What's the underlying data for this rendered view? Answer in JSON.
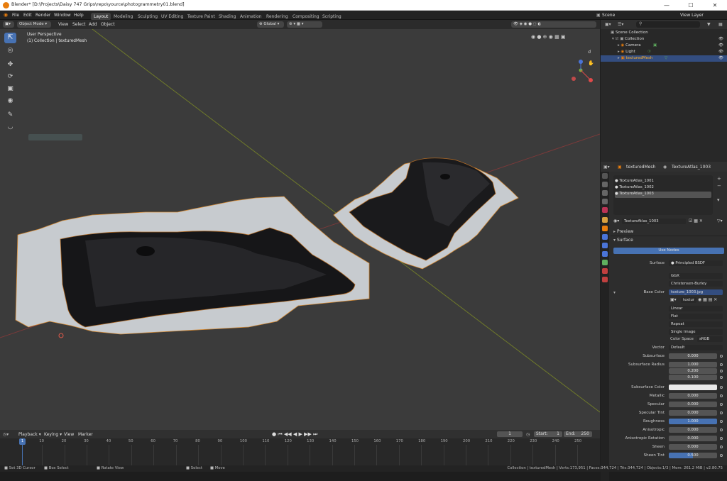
{
  "titlebar": {
    "title": "Blender* [D:\\Projects\\Daisy 747 Grips\\repo\\yource\\photogrammetry01.blend]"
  },
  "menu": {
    "items": [
      "File",
      "Edit",
      "Render",
      "Window",
      "Help"
    ]
  },
  "workspaces": [
    "Layout",
    "Modeling",
    "Sculpting",
    "UV Editing",
    "Texture Paint",
    "Shading",
    "Animation",
    "Rendering",
    "Compositing",
    "Scripting"
  ],
  "active_workspace": "Layout",
  "scene": {
    "label": "Scene",
    "view_layer": "View Layer"
  },
  "viewport": {
    "mode": "Object Mode",
    "menus": [
      "View",
      "Select",
      "Add",
      "Object"
    ],
    "orientation": "Global",
    "overlay_title": "User Perspective",
    "overlay_sub": "(1) Collection | texturedMesh"
  },
  "outliner": {
    "rows": [
      {
        "label": "Scene Collection"
      },
      {
        "label": "Collection"
      },
      {
        "label": "Camera"
      },
      {
        "label": "Light"
      },
      {
        "label": "texturedMesh"
      }
    ]
  },
  "properties": {
    "object": "texturedMesh",
    "material_slot": "TextureAtlas_1003",
    "slots": [
      "TextureAtlas_1001",
      "TextureAtlas_1002",
      "TextureAtlas_1003"
    ],
    "material_name": "TextureAtlas_1003",
    "preview": "Preview",
    "surface_header": "Surface",
    "use_nodes": "Use Nodes",
    "surface_label": "Surface",
    "surface_value": "Principled BSDF",
    "distribution": "GGX",
    "subsurface_method": "Christensen-Burley",
    "base_color_label": "Base Color",
    "base_color_value": "texture_1003.jpg",
    "image_name": "textur",
    "interpolation": "Linear",
    "projection": "Flat",
    "extension": "Repeat",
    "source": "Single Image",
    "color_space_label": "Color Space",
    "color_space_value": "sRGB",
    "vector_label": "Vector",
    "vector_value": "Default",
    "params": [
      {
        "label": "Subsurface",
        "value": "0.000",
        "fill": 0
      },
      {
        "label": "Subsurface Radius",
        "value": "1.000",
        "fill": 0
      },
      {
        "label": "",
        "value": "0.200",
        "fill": 0
      },
      {
        "label": "",
        "value": "0.100",
        "fill": 0
      },
      {
        "label": "Subsurface Color",
        "value": "",
        "fill": 0
      },
      {
        "label": "Metallic",
        "value": "0.000",
        "fill": 0
      },
      {
        "label": "Specular",
        "value": "0.000",
        "fill": 0
      },
      {
        "label": "Specular Tint",
        "value": "0.000",
        "fill": 0
      },
      {
        "label": "Roughness",
        "value": "1.000",
        "fill": 1
      },
      {
        "label": "Anisotropic",
        "value": "0.000",
        "fill": 0
      },
      {
        "label": "Anisotropic Rotation",
        "value": "0.000",
        "fill": 0
      },
      {
        "label": "Sheen",
        "value": "0.000",
        "fill": 0
      },
      {
        "label": "Sheen Tint",
        "value": "0.500",
        "fill": 0.5
      }
    ]
  },
  "timeline": {
    "menus": [
      "Playback",
      "Keying",
      "View",
      "Marker"
    ],
    "current_frame": "1",
    "start_label": "Start:",
    "start": "1",
    "end_label": "End:",
    "end": "250",
    "ticks": [
      "1",
      "10",
      "20",
      "30",
      "40",
      "50",
      "60",
      "70",
      "80",
      "90",
      "100",
      "110",
      "120",
      "130",
      "140",
      "150",
      "160",
      "170",
      "180",
      "190",
      "200",
      "210",
      "220",
      "230",
      "240",
      "250"
    ],
    "playhead": "1"
  },
  "statusbar": {
    "left": [
      "Set 3D Cursor",
      "Box Select",
      "Rotate View",
      "Select",
      "Move"
    ],
    "right": "Collection | texturedMesh | Verts:173,951 | Faces:344,724 | Tris:344,724 | Objects:1/3 | Mem: 261.2 MiB | v2.80.75"
  },
  "colors": {
    "accent": "#4772b3",
    "selection": "#334d80",
    "orange": "#e87d0d"
  },
  "icons": [
    "blender-logo-icon",
    "minimize-icon",
    "maximize-icon",
    "close-icon",
    "cursor-icon",
    "move-icon",
    "rotate-icon",
    "scale-icon",
    "transform-icon",
    "annotate-icon",
    "measure-icon",
    "eye-icon",
    "camera-icon",
    "light-icon",
    "mesh-icon",
    "search-icon",
    "filter-icon",
    "material-icon"
  ]
}
